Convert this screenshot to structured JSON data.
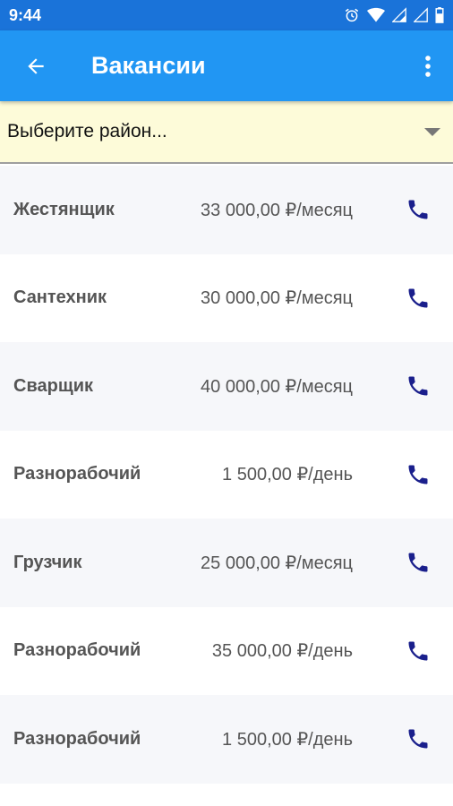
{
  "status_bar": {
    "time": "9:44",
    "icons": [
      "alarm-icon",
      "wifi-icon",
      "signal-icon",
      "signal-icon",
      "battery-icon"
    ]
  },
  "app_bar": {
    "title": "Вакансии",
    "back_icon": "arrow-left-icon",
    "menu_icon": "more-vertical-icon"
  },
  "filter": {
    "district_placeholder": "Выберите район..."
  },
  "colors": {
    "status_bar": "#1a73d9",
    "app_bar": "#2196f3",
    "filter_bg": "#fdfbd9",
    "phone_icon": "#1a1f8c"
  },
  "vacancies": [
    {
      "title": "Жестянщик",
      "salary": "33 000,00 ₽/месяц"
    },
    {
      "title": "Сантехник",
      "salary": "30 000,00 ₽/месяц"
    },
    {
      "title": "Сварщик",
      "salary": "40 000,00 ₽/месяц"
    },
    {
      "title": "Разнорабочий",
      "salary": "1 500,00 ₽/день"
    },
    {
      "title": "Грузчик",
      "salary": "25 000,00 ₽/месяц"
    },
    {
      "title": "Разнорабочий",
      "salary": "35 000,00 ₽/день"
    },
    {
      "title": "Разнорабочий",
      "salary": "1 500,00 ₽/день"
    }
  ]
}
